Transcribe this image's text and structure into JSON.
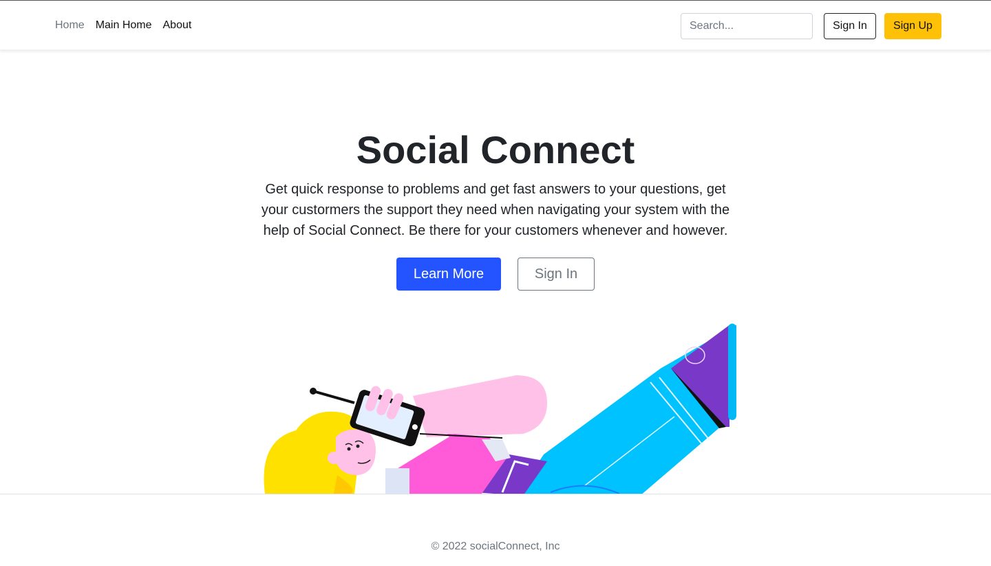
{
  "nav": {
    "links": [
      {
        "label": "Home",
        "active": true
      },
      {
        "label": "Main Home",
        "active": false
      },
      {
        "label": "About",
        "active": false
      }
    ],
    "search_placeholder": "Search...",
    "signin_label": "Sign In",
    "signup_label": "Sign Up"
  },
  "hero": {
    "title": "Social Connect",
    "description": "Get quick response to problems and get fast answers to your questions, get your custormers the support they need when navigating your system with the help of Social Connect. Be there for your customers whenever and however.",
    "learn_more_label": "Learn More",
    "signin_label": "Sign In",
    "illustration": "person-lying-with-phone-illustration"
  },
  "footer": {
    "copyright": "© 2022 socialConnect, Inc"
  },
  "colors": {
    "primary": "#2454ff",
    "warning": "#ffc107",
    "text": "#212529",
    "muted": "#6c757d"
  }
}
